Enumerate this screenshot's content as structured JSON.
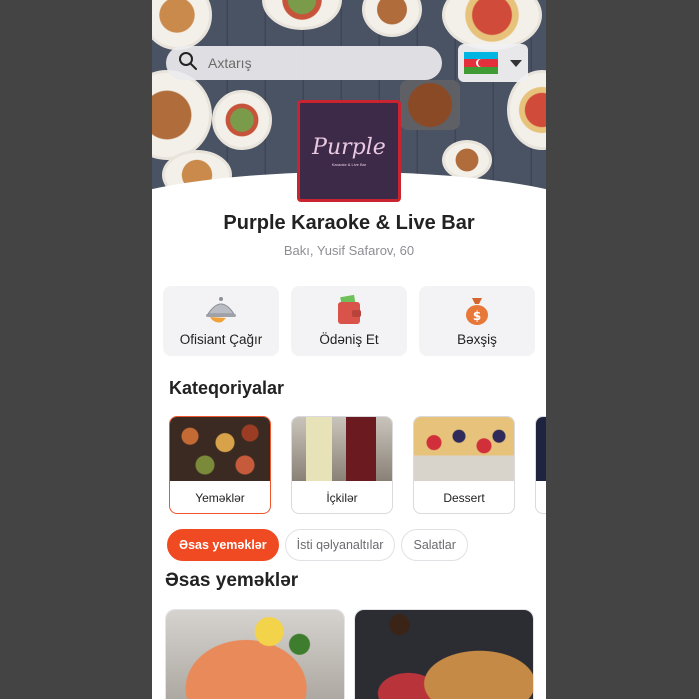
{
  "search": {
    "placeholder": "Axtarış"
  },
  "language": {
    "flag": "azerbaijan-flag-icon",
    "colors": [
      "#00b5e2",
      "#e4303c",
      "#3f9c35"
    ]
  },
  "venue": {
    "logo_script": "Purple",
    "logo_subtitle": "Karaoke & Live Bar",
    "name": "Purple Karaoke & Live Bar",
    "address": "Bakı, Yusif Safarov, 60"
  },
  "actions": [
    {
      "label": "Ofisiant Çağır",
      "icon": "waiter-cloche-icon"
    },
    {
      "label": "Ödəniş Et",
      "icon": "wallet-icon"
    },
    {
      "label": "Bəxşiş",
      "icon": "money-bag-icon"
    }
  ],
  "categories_title": "Kateqoriyalar",
  "categories": [
    {
      "label": "Yeməklər",
      "active": true
    },
    {
      "label": "İçkilər",
      "active": false
    },
    {
      "label": "Dessert",
      "active": false
    },
    {
      "label": "",
      "active": false
    }
  ],
  "subcategories": [
    {
      "label": "Əsas yeməklər",
      "active": true
    },
    {
      "label": "İsti qəlyanaltılar",
      "active": false
    },
    {
      "label": "Salatlar",
      "active": false
    }
  ],
  "section_title": "Əsas yeməklər",
  "colors": {
    "accent": "#f04a22",
    "logo_bg": "#3d2a48",
    "logo_border": "#c9242f"
  }
}
